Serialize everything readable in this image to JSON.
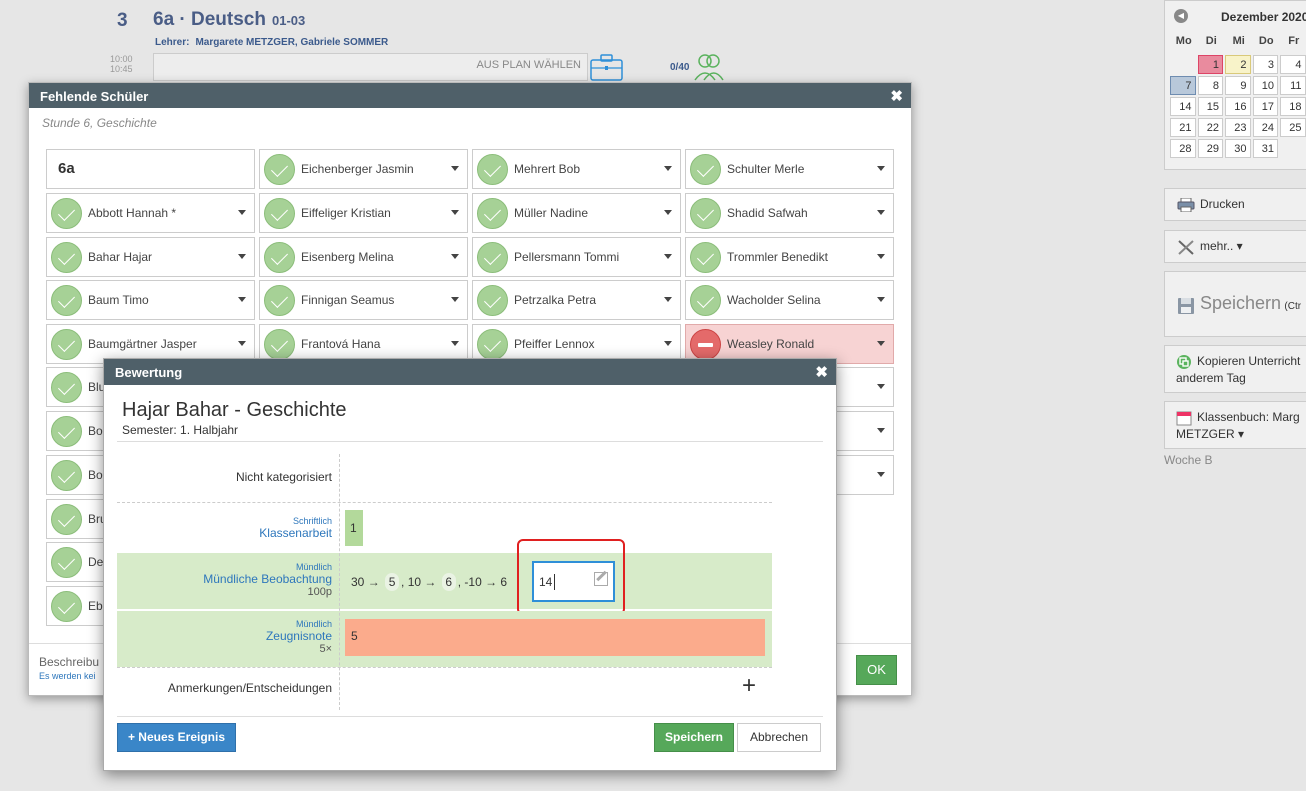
{
  "lesson": {
    "number": "3",
    "title": "6a · Deutsch",
    "code": "01-03",
    "teacher_label": "Lehrer:",
    "teachers": "Margarete METZGER, Gabriele SOMMER",
    "time_start": "10:00",
    "time_end": "10:45",
    "plan_button": "AUS PLAN WÄHLEN",
    "count": "0/40"
  },
  "calendar": {
    "month": "Dezember 2020",
    "weekdays": [
      "Mo",
      "Di",
      "Mi",
      "Do",
      "Fr"
    ],
    "rows": [
      [
        "",
        "1",
        "2",
        "3",
        "4"
      ],
      [
        "7",
        "8",
        "9",
        "10",
        "11"
      ],
      [
        "14",
        "15",
        "16",
        "17",
        "18"
      ],
      [
        "21",
        "22",
        "23",
        "24",
        "25"
      ],
      [
        "28",
        "29",
        "30",
        "31",
        ""
      ]
    ]
  },
  "sidebar": {
    "print": "Drucken",
    "more": "mehr.. ▾",
    "save": "Speichern",
    "save_hint": "(Ctr",
    "copy_line1": "Kopieren Unterricht",
    "copy_line2": "anderem Tag",
    "classbook_line1": "Klassenbuch: Marg",
    "classbook_line2": "METZGER ▾",
    "week": "Woche B"
  },
  "missing_dialog": {
    "title": "Fehlende Schüler",
    "subtitle": "Stunde 6, Geschichte",
    "class_name": "6a",
    "col1": [
      "Abbott Hannah *",
      "Bahar Hajar",
      "Baum Timo",
      "Baumgärtner Jasper",
      "Blu",
      "Bo",
      "Bo",
      "Bru",
      "De",
      "Eb"
    ],
    "col2": [
      "Eichenberger Jasmin",
      "Eiffeliger Kristian",
      "Eisenberg Melina",
      "Finnigan Seamus",
      "Frantová Hana"
    ],
    "col3": [
      "Mehrert Bob",
      "Müller Nadine",
      "Pellersmann Tommi",
      "Petrzalka Petra",
      "Pfeiffer Lennox"
    ],
    "col4": [
      "Schulter Merle",
      "Shadid Safwah",
      "Trommler Benedikt",
      "Wacholder Selina",
      "Weasley Ronald"
    ],
    "description": "Beschreibu",
    "description_hint": "Es werden kei",
    "ok": "OK"
  },
  "grading_dialog": {
    "title": "Bewertung",
    "student_subject": "Hajar Bahar - Geschichte",
    "semester": "Semester: 1. Halbjahr",
    "uncategorized": "Nicht kategorisiert",
    "written_cat": "Schriftlich",
    "written_name": "Klassenarbeit",
    "written_grade": "1",
    "oral_cat": "Mündlich",
    "oral_name": "Mündliche Beobachtung",
    "oral_points": "100p",
    "chain": [
      "30",
      "5",
      "10",
      "6",
      "-10",
      "6"
    ],
    "input_value": "14",
    "report_cat": "Mündlich",
    "report_name": "Zeugnisnote",
    "report_weight": "5×",
    "report_grade": "5",
    "remarks": "Anmerkungen/Entscheidungen",
    "new_event": "+ Neues Ereignis",
    "save": "Speichern",
    "cancel": "Abbrechen"
  },
  "colors": {
    "header": "#4f6069",
    "accent_blue": "#2e77bc",
    "ok_green": "#56a85a",
    "present_green": "#a6d196",
    "absent_red": "#e46a6a",
    "zeugnis_orange": "#fbab8c"
  }
}
